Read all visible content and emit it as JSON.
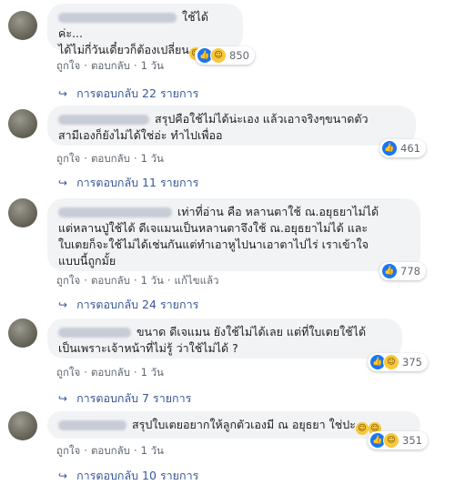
{
  "comments": [
    {
      "text_line1": "ใช้ได้ค่ะ...",
      "text_line2": "ได้ไม่กี่วันเดี๋ยวก็ต้องเปลี่ยน",
      "like": "ถูกใจ",
      "reply": "ตอบกลับ",
      "time": "1 วัน",
      "reaction_count": "850",
      "replies_label": "การตอบกลับ 22 รายการ"
    },
    {
      "text_line1": "สรุปคือใช้ไม่ได้น่ะเอง แล้วเอาจริงๆขนาดตัว",
      "text_line2": "สามีเองก็ยังไม่ได้ใช่อ่ะ ทำไปเพื่ออ",
      "like": "ถูกใจ",
      "reply": "ตอบกลับ",
      "time": "1 วัน",
      "reaction_count": "461",
      "replies_label": "การตอบกลับ 11 รายการ"
    },
    {
      "text_line1": "เท่าที่อ่าน คือ หลานตาใช้ ณ.อยุธยาไม่ได้",
      "text_line2": "แต่หลานปู่ใช้ได้ ดีเจแมนเป็นหลานตาจึงใช้ ณ.อยุธยาไม่ได้ และ",
      "text_line3": "ใบเตยก็จะใช้ไม่ได้เช่นกันแต่ทำเอาหูไปนาเอาตาไปไร่ เราเข้าใจ",
      "text_line4": "แบบนี้ถูกมั้ย",
      "like": "ถูกใจ",
      "reply": "ตอบกลับ",
      "time": "1 วัน",
      "edited": "แก้ไขแล้ว",
      "reaction_count": "778",
      "replies_label": "การตอบกลับ 24 รายการ"
    },
    {
      "text_line1": "ขนาด ดีเจแมน ยังใช้ไม่ได้เลย แต่ที่ใบเตยใช้ได้",
      "text_line2": "เป็นเพราะเจ้าหน้าที่ไม่รู้ ว่าใช้ไม่ได้ ?",
      "like": "ถูกใจ",
      "reply": "ตอบกลับ",
      "time": "1 วัน",
      "reaction_count": "375",
      "replies_label": "การตอบกลับ 7 รายการ"
    },
    {
      "text_line1": "สรุปใบเตยอยากให้ลูกตัวเองมี ณ อยุธยา ใช่ปะ",
      "like": "ถูกใจ",
      "reply": "ตอบกลับ",
      "time": "1 วัน",
      "reaction_count": "351",
      "replies_label": "การตอบกลับ 10 รายการ"
    }
  ],
  "icons": {
    "like": "thumbs-up-icon",
    "haha": "laughing-face-icon",
    "reply_arrow": "reply-arrow-icon",
    "emoji": "grinning-face-emoji"
  }
}
